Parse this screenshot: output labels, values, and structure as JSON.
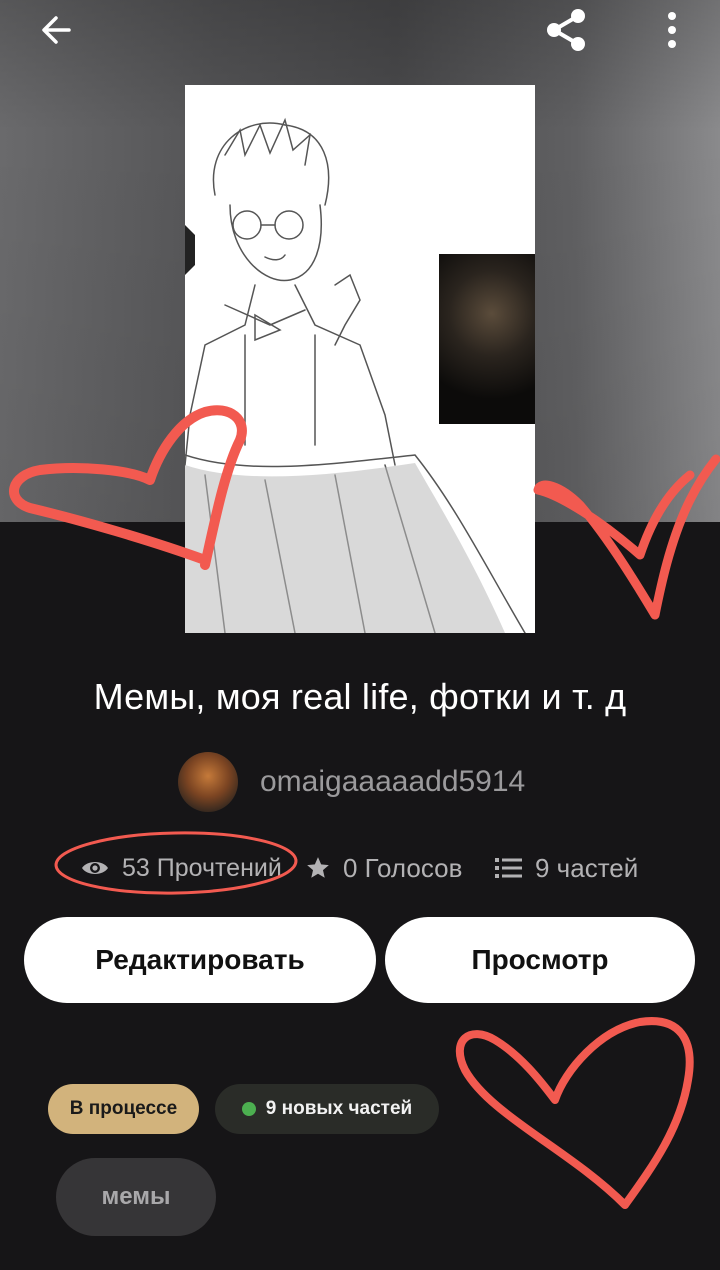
{
  "header": {
    "back_icon": "arrow-left-icon",
    "share_icon": "share-icon",
    "more_icon": "more-vertical-icon"
  },
  "story": {
    "title": "Мемы, моя real life, фотки и т. д",
    "author": "omaigaaaaadd5914",
    "stats": {
      "reads": "53 Прочтений",
      "votes": "0 Голосов",
      "parts": "9 частей"
    }
  },
  "actions": {
    "edit_label": "Редактировать",
    "view_label": "Просмотр"
  },
  "chips": {
    "status": "В процессе",
    "new_parts": "9 новых частей"
  },
  "tags": [
    "мемы"
  ],
  "colors": {
    "background": "#161517",
    "status_chip": "#d2b37c",
    "new_parts_dot": "#4caf50",
    "annotation_red": "#f25a50"
  }
}
